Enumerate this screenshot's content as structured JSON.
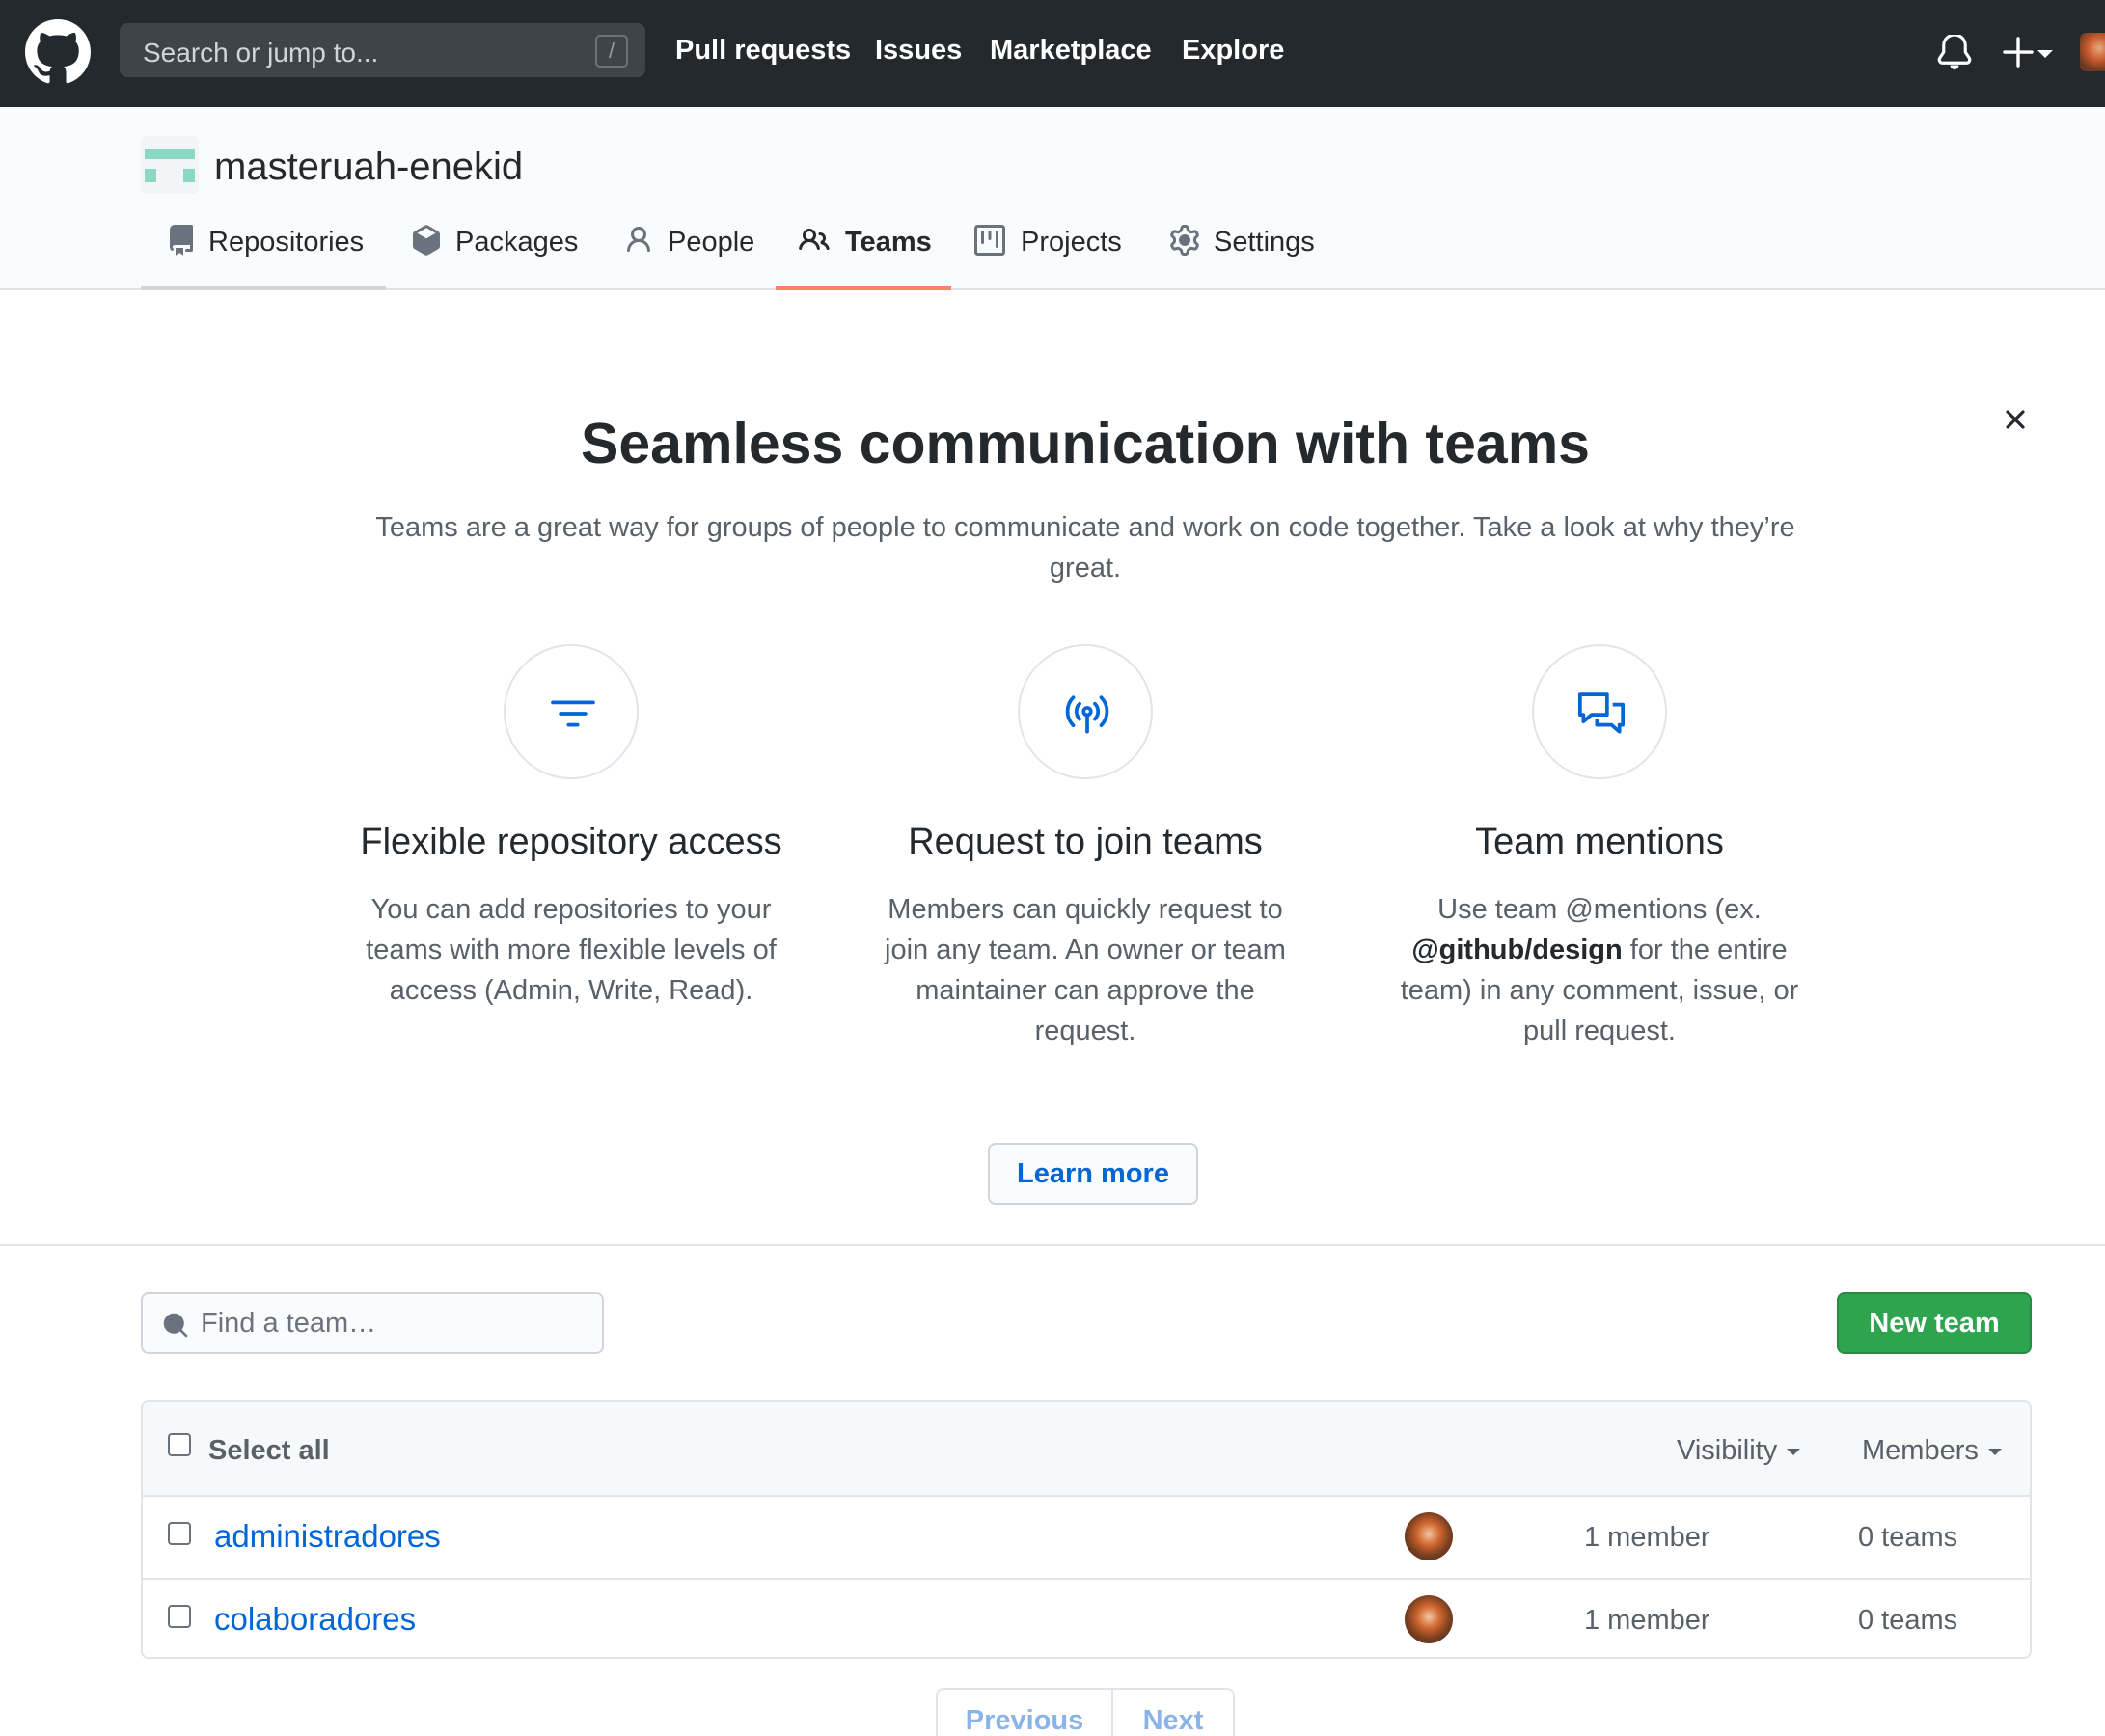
{
  "header": {
    "search_placeholder": "Search or jump to...",
    "search_shortcut": "/",
    "nav": [
      "Pull requests",
      "Issues",
      "Marketplace",
      "Explore"
    ],
    "icons": [
      "github-logo-icon",
      "bell-icon",
      "plus-icon",
      "avatar"
    ]
  },
  "org": {
    "name": "masteruah-enekid",
    "tabs": [
      {
        "label": "Repositories",
        "icon": "repo-icon"
      },
      {
        "label": "Packages",
        "icon": "package-icon"
      },
      {
        "label": "People",
        "icon": "person-icon"
      },
      {
        "label": "Teams",
        "icon": "people-icon",
        "active": true
      },
      {
        "label": "Projects",
        "icon": "project-icon"
      },
      {
        "label": "Settings",
        "icon": "gear-icon"
      }
    ]
  },
  "promo": {
    "title": "Seamless communication with teams",
    "subtitle": "Teams are a great way for groups of people to communicate and work on code together. Take a look at why they’re great.",
    "features": [
      {
        "title": "Flexible repository access",
        "description": "You can add repositories to your teams with more flexible levels of access (Admin, Write, Read).",
        "icon": "filter-icon"
      },
      {
        "title": "Request to join teams",
        "description": "Members can quickly request to join any team. An owner or team maintainer can approve the request.",
        "icon": "broadcast-icon"
      },
      {
        "title": "Team mentions",
        "description_before": "Use team @mentions (ex.",
        "description_bold": "@github/design",
        "description_after": "for the entire team) in any comment, issue, or pull request.",
        "icon": "comment-discussion-icon"
      }
    ],
    "learn_more": "Learn more"
  },
  "teams": {
    "search_placeholder": "Find a team…",
    "new_team": "New team",
    "select_all": "Select all",
    "visibility": "Visibility",
    "members": "Members",
    "rows": [
      {
        "name": "administradores",
        "members": "1 member",
        "teams": "0 teams"
      },
      {
        "name": "colaboradores",
        "members": "1 member",
        "teams": "0 teams"
      }
    ]
  },
  "pagination": {
    "previous": "Previous",
    "next": "Next"
  },
  "colors": {
    "header_bg": "#24292e",
    "accent_tab": "#f9826c",
    "link": "#0366d6",
    "primary_button": "#2ea44f"
  }
}
